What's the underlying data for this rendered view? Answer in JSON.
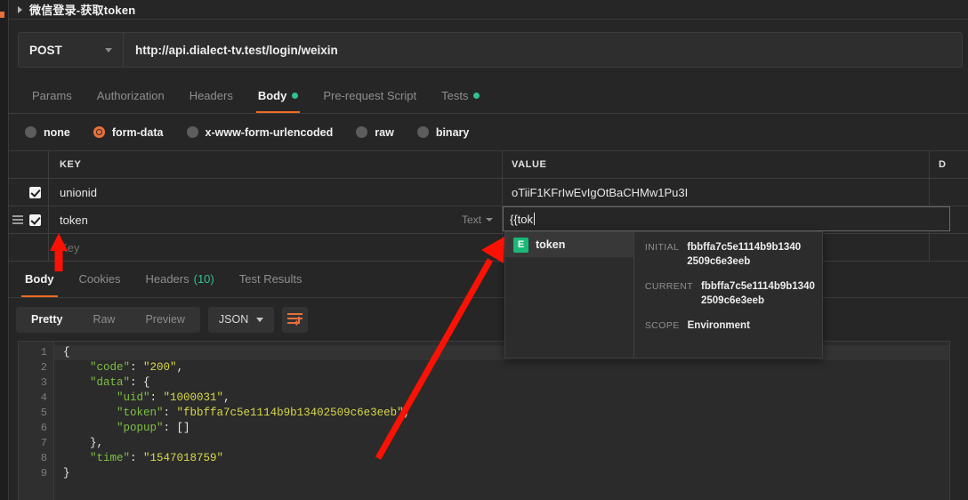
{
  "window": {
    "title": "微信登录-获取token",
    "collapse_icon": "caret-right-icon"
  },
  "request": {
    "method": "POST",
    "url": "http://api.dialect-tv.test/login/weixin",
    "tabs": [
      {
        "label": "Params",
        "active": false,
        "dot": false
      },
      {
        "label": "Authorization",
        "active": false,
        "dot": false
      },
      {
        "label": "Headers",
        "active": false,
        "dot": false
      },
      {
        "label": "Body",
        "active": true,
        "dot": true
      },
      {
        "label": "Pre-request Script",
        "active": false,
        "dot": false
      },
      {
        "label": "Tests",
        "active": false,
        "dot": true
      }
    ],
    "body_types": [
      {
        "label": "none",
        "selected": false
      },
      {
        "label": "form-data",
        "selected": true
      },
      {
        "label": "x-www-form-urlencoded",
        "selected": false
      },
      {
        "label": "raw",
        "selected": false
      },
      {
        "label": "binary",
        "selected": false
      }
    ],
    "table": {
      "headers": {
        "key": "KEY",
        "value": "VALUE",
        "description": "D"
      },
      "rows": [
        {
          "checked": true,
          "key": "unionid",
          "value": "oTiiF1KFrIwEvIgOtBaCHMw1Pu3I",
          "description": "",
          "type": "",
          "editing": false,
          "dragger": false
        },
        {
          "checked": true,
          "key": "token",
          "value": "{{tok",
          "description": "",
          "type": "Text",
          "editing": true,
          "dragger": true
        },
        {
          "checked": false,
          "key": "Key",
          "value": "",
          "description": "",
          "type": "",
          "editing": false,
          "dragger": false
        }
      ]
    },
    "autocomplete": {
      "badge": "E",
      "name": "token",
      "fields": [
        {
          "label": "INITIAL",
          "value": "fbbffa7c5e1114b9b13402509c6e3eeb"
        },
        {
          "label": "CURRENT",
          "value": "fbbffa7c5e1114b9b13402509c6e3eeb"
        },
        {
          "label": "SCOPE",
          "value": "Environment"
        }
      ]
    }
  },
  "response": {
    "tabs": [
      {
        "label": "Body",
        "active": true,
        "count": ""
      },
      {
        "label": "Cookies",
        "active": false,
        "count": ""
      },
      {
        "label": "Headers",
        "active": false,
        "count": "(10)"
      },
      {
        "label": "Test Results",
        "active": false,
        "count": ""
      }
    ],
    "view_modes": [
      {
        "label": "Pretty",
        "active": true
      },
      {
        "label": "Raw",
        "active": false
      },
      {
        "label": "Preview",
        "active": false
      }
    ],
    "format": "JSON",
    "wrap_icon": "wrap-text-icon",
    "code_lines": [
      {
        "n": "1",
        "text": "{"
      },
      {
        "n": "2",
        "text": "    \"code\": \"200\","
      },
      {
        "n": "3",
        "text": "    \"data\": {"
      },
      {
        "n": "4",
        "text": "        \"uid\": \"1000031\","
      },
      {
        "n": "5",
        "text": "        \"token\": \"fbbffa7c5e1114b9b13402509c6e3eeb\","
      },
      {
        "n": "6",
        "text": "        \"popup\": []"
      },
      {
        "n": "7",
        "text": "    },"
      },
      {
        "n": "8",
        "text": "    \"time\": \"1547018759\""
      },
      {
        "n": "9",
        "text": "}"
      }
    ]
  },
  "colors": {
    "accent": "#f26b21",
    "green_dot": "#32c08e",
    "annotation": "#fb1205",
    "badge": "#1ab877"
  }
}
